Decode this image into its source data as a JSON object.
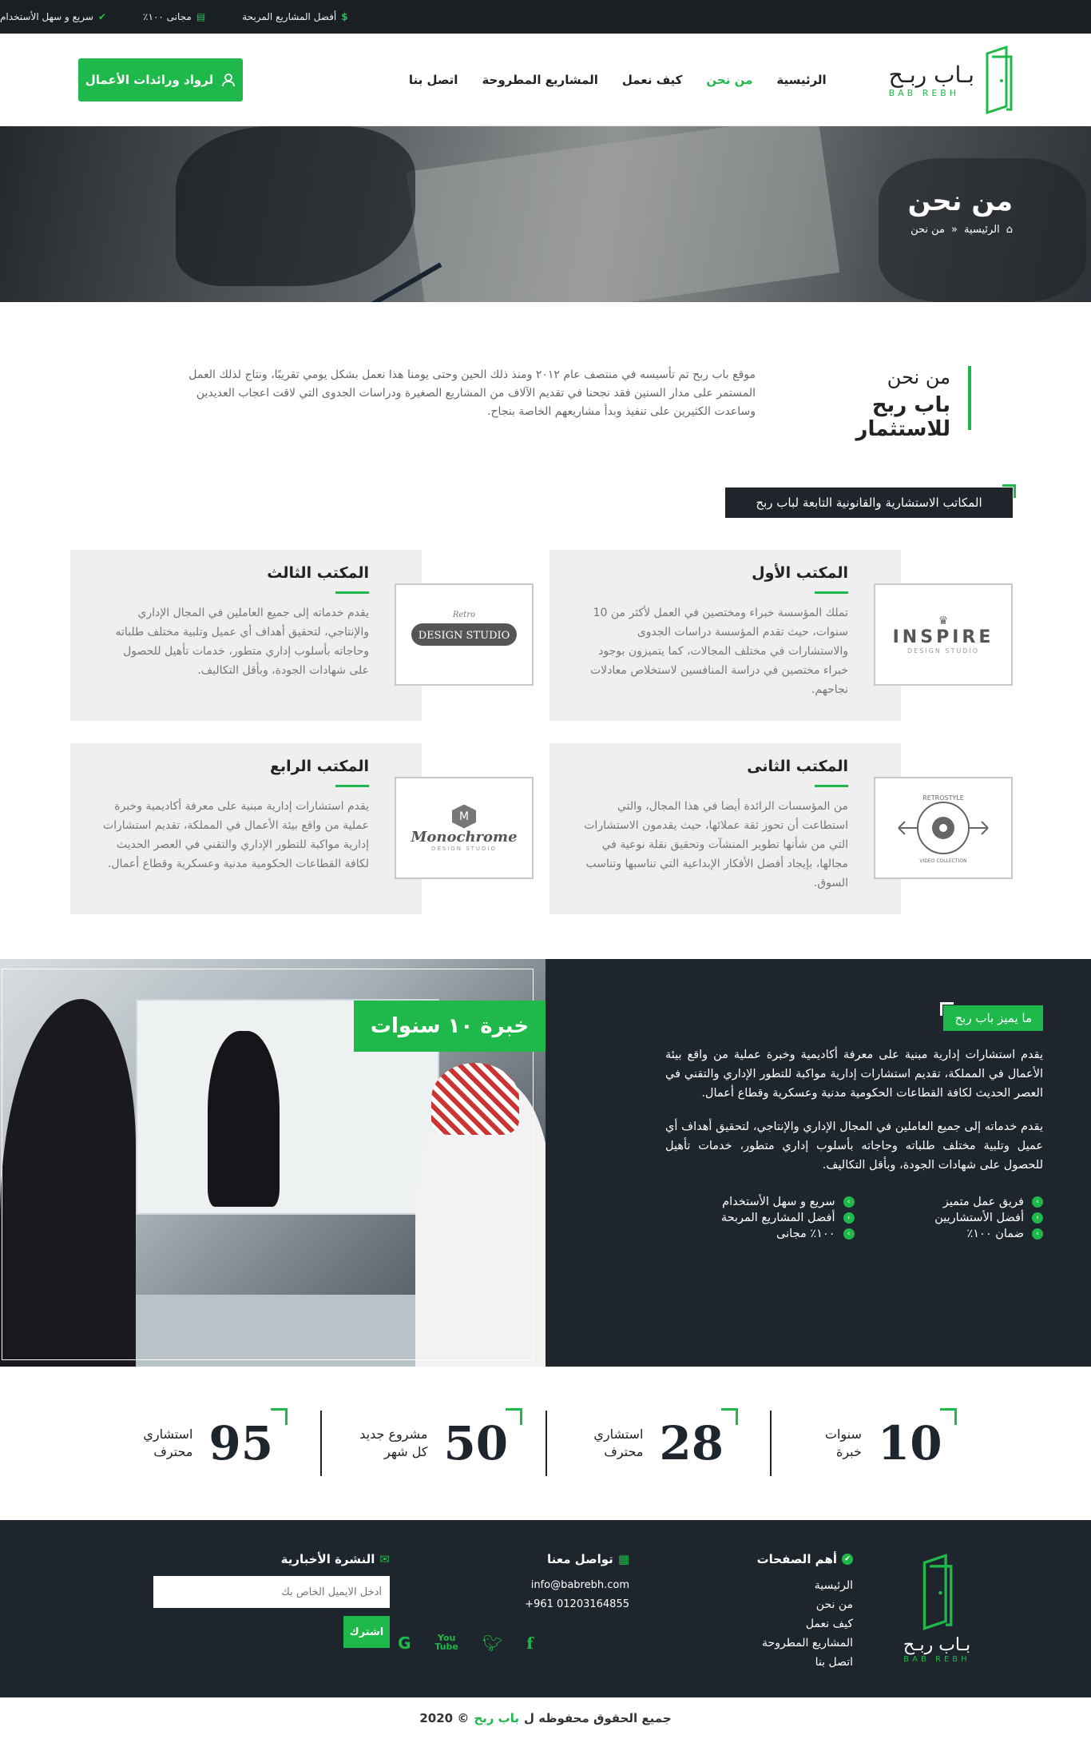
{
  "topbar": {
    "items": [
      {
        "icon": "dollar-icon",
        "text": "أفضل المشاريع المربحة"
      },
      {
        "icon": "money-icon",
        "text": "مجانى ١٠٠٪"
      },
      {
        "icon": "check-circle-icon",
        "text": "سريع و سهل الأستخدام"
      }
    ]
  },
  "header": {
    "logo_ar": "بـاب ربـح",
    "logo_en": "BAB REBH",
    "nav": [
      "الرئيسية",
      "من نحن",
      "كيف نعمل",
      "المشاريع المطروحة",
      "اتصل بنا"
    ],
    "active_nav": "من نحن",
    "cta": "لرواد ورائدات الأعمال"
  },
  "hero": {
    "title": "من نحن",
    "crumb_home": "الرئيسية",
    "crumb_sep": "»",
    "crumb_current": "من نحن"
  },
  "about": {
    "title1": "من نحن",
    "title2": "باب ربح للاستثمار",
    "text": "موقع باب ربح تم تأسيسه في منتصف عام ٢٠١٢ ومنذ ذلك الحين وحتى يومنا هذا نعمل بشكل يومي تقريبًا، ونتاج لذلك العمل المستمر على مدار السنين فقد نجحنا في تقديم الآلاف من المشاريع الصغيرة ودراسات الجدوى التي لاقت اعجاب العديدين وساعدت الكثيرين على تنفيذ وبدأ مشاريعهم الخاصة بنجاح."
  },
  "offices": {
    "heading": "المكاتب الاستشارية والقانونية التابعة لباب ربح",
    "items": [
      {
        "title": "المكتب الأول",
        "logo": "INSPIRE",
        "logo_sub": "DESIGN STUDIO",
        "text": "تملك المؤسسة خبراء ومختصين في العمل لأكثر من 10 سنوات، حيث تقدم المؤسسة دراسات الجدوى والاستشارات في مختلف المجالات، كما يتميزون بوجود خبراء مختصين في دراسة المنافسين لاستخلاص معادلات نجاحهم."
      },
      {
        "title": "المكتب الثالث",
        "logo": "DESIGN STUDIO",
        "logo_sub": "Retro",
        "text": "يقدم خدماته إلى جميع العاملين في المجال الإداري والإنتاجي، لتحقيق أهداف أي عميل وتلبية مختلف طلباته وحاجاته بأسلوب إداري متطور، خدمات تأهيل للحصول على شهادات الجودة، وبأقل التكاليف."
      },
      {
        "title": "المكتب الثانى",
        "logo": "RETROSTYLE",
        "logo_sub": "VIDEO COLLECTION",
        "text": "من المؤسسات الرائدة أيضا في هذا المجال، والتي استطاعت أن تحوز ثقة عملائها، حيث يقدمون الاستشارات التي من شأنها تطوير المنشآت وتحقيق نقلة نوعية في مجالها، بإيجاد أفضل الأفكار الإبداعية التي تناسبها وتناسب السوق."
      },
      {
        "title": "المكتب الرابع",
        "logo": "Monochrome",
        "logo_sub": "DESIGN STUDIO",
        "text": "يقدم استشارات إدارية مبنية على معرفة أكاديمية وخبرة عملية من واقع بيئة الأعمال في المملكة، تقديم استشارات إدارية مواكبة للتطور الإداري والتقني في العصر الحديث لكافة القطاعات الحكومية مدنية وعسكرية وقطاع أعمال."
      }
    ]
  },
  "why": {
    "tag": "ما يميز باب ربح",
    "experience": "خبرة ١٠ سنوات",
    "p1": "يقدم استشارات إدارية مبنية على معرفة أكاديمية وخبرة عملية من واقع بيئة الأعمال في المملكة، تقديم استشارات إدارية مواكبة للتطور الإداري والتقني في العصر الحديث لكافة القطاعات الحكومية مدنية وعسكرية وقطاع أعمال.",
    "p2": "يقدم خدماته إلى جميع العاملين في المجال الإداري والإنتاجي، لتحقيق أهداف أي عميل وتلبية مختلف طلباته وحاجاته بأسلوب إداري متطور، خدمات تأهيل للحصول على شهادات الجودة، وبأقل التكاليف.",
    "features": [
      "فريق عمل متميز",
      "سريع و سهل الأستخدام",
      "أفضل الأستشاريين",
      "أفضل المشاريع المربحة",
      "ضمان ١٠٠٪",
      "١٠٠٪ مجانى"
    ]
  },
  "stats": [
    {
      "num": "10",
      "l1": "سنوات",
      "l2": "خبرة"
    },
    {
      "num": "28",
      "l1": "استشاري",
      "l2": "محترف"
    },
    {
      "num": "50",
      "l1": "مشروع جديد",
      "l2": "كل شهر"
    },
    {
      "num": "95",
      "l1": "استشاري",
      "l2": "محترف"
    }
  ],
  "footer": {
    "logo_ar": "بـاب ربـح",
    "logo_en": "BAB REBH",
    "pages_title": "أهم الصفحات",
    "pages": [
      "الرئيسية",
      "من نحن",
      "كيف نعمل",
      "المشاريع المطروحة",
      "اتصل بنا"
    ],
    "contact_title": "تواصل معنا",
    "email": "info@babrebh.com",
    "phone": "+961 01203164855",
    "newsletter_title": "النشرة الأخبارية",
    "email_placeholder": "أدخل الايميل الخاص بك",
    "subscribe": "اشترك"
  },
  "copyright": {
    "pre": "جميع الحقوق محفوظه ل",
    "brand": "باب ربح",
    "post": "© 2020"
  },
  "colors": {
    "accent": "#1fb84a",
    "dark": "#1e252d"
  }
}
